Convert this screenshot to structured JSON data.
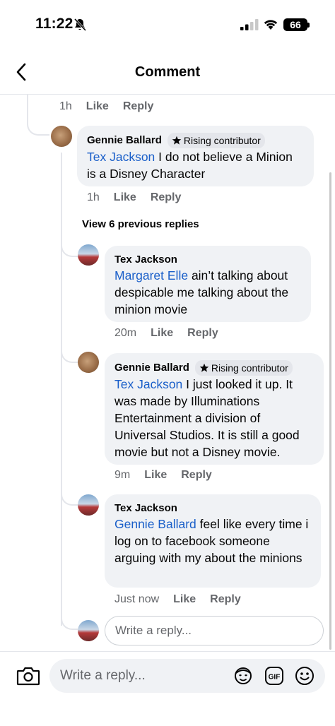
{
  "status_bar": {
    "time": "11:22",
    "battery": "66"
  },
  "nav": {
    "title": "Comment"
  },
  "top_meta": {
    "time": "1h",
    "like": "Like",
    "reply": "Reply"
  },
  "comments": [
    {
      "author": "Gennie Ballard",
      "badge": "Rising contributor",
      "mention": "Tex Jackson",
      "text": " I do not believe a Minion is a Disney Character",
      "time": "1h",
      "like": "Like",
      "reply": "Reply"
    },
    {
      "author": "Tex Jackson",
      "mention": "Margaret Elle",
      "text": " ain’t talking about despicable me talking about the minion movie",
      "time": "20m",
      "like": "Like",
      "reply": "Reply"
    },
    {
      "author": "Gennie Ballard",
      "badge": "Rising contributor",
      "mention": "Tex Jackson",
      "text": " I just looked it up.  It was made by Illuminations Entertainment a division of Universal Studios.  It is still a good movie but not a Disney movie.",
      "time": "9m",
      "like": "Like",
      "reply": "Reply"
    },
    {
      "author": "Tex Jackson",
      "mention": "Gennie Ballard",
      "text": " feel like every time i log on to facebook someone arguing with my about the minions",
      "time": "Just now",
      "like": "Like",
      "reply": "Reply"
    }
  ],
  "view_previous": "View 6 previous replies",
  "inline_reply": {
    "placeholder": "Write a reply..."
  },
  "composer": {
    "placeholder": "Write a reply..."
  },
  "icons": [
    "back-chevron-icon",
    "bell-off-icon",
    "signal-icon",
    "wifi-icon",
    "camera-icon",
    "avatar-sticker-icon",
    "gif-icon",
    "emoji-icon",
    "star-icon"
  ],
  "colors": {
    "mention": "#1a5fc9",
    "bubble": "#f0f2f5",
    "meta": "#65676b"
  }
}
